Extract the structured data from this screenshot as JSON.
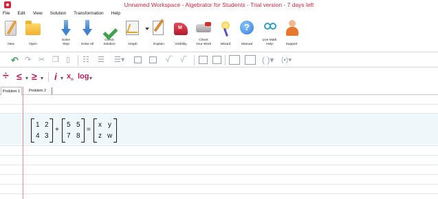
{
  "window": {
    "title": "Unnamed Workspace - Algebrator for Students - Trial version - 7 days left",
    "accent_color": "#d7263d"
  },
  "menu": [
    "File",
    "Edit",
    "View",
    "Solution",
    "Transformation",
    "Help"
  ],
  "toolbar": {
    "new": "New",
    "open": "Open",
    "solve_step_1": "Solve",
    "solve_step_2": "Step",
    "solve_all": "Solve All",
    "check_solution_1": "Check",
    "check_solution_2": "Solution",
    "graph": "Graph",
    "explain": "Explain",
    "visibility": "Visibility",
    "check_work_1": "Check",
    "check_work_2": "Your Work",
    "wizard": "Wizard",
    "manual": "Manual",
    "live_help_1": "Live Math",
    "live_help_2": "Help",
    "support": "Support"
  },
  "math_toolbar": {
    "divide": "÷",
    "less_equal": "≤",
    "greater_equal": "≥",
    "imaginary": "i",
    "subscript_x": "x",
    "subscript_label": "n",
    "log": "log",
    "dropdown": "▾"
  },
  "tabs": [
    {
      "label": "Problem 1",
      "active": true
    },
    {
      "label": "Problem 2",
      "active": false
    }
  ],
  "expression": {
    "matrix_a": [
      "1",
      "2",
      "4",
      "3"
    ],
    "plus": "+",
    "matrix_b": [
      "5",
      "5",
      "7",
      "8"
    ],
    "equals": "=",
    "matrix_c": [
      "x",
      "y",
      "z",
      "w"
    ]
  },
  "icons": [
    "new-icon",
    "open-icon",
    "solve-step-icon",
    "solve-all-icon",
    "check-solution-icon",
    "graph-icon",
    "explain-icon",
    "visibility-icon",
    "check-work-icon",
    "wizard-icon",
    "manual-icon",
    "live-help-icon",
    "support-icon",
    "undo-icon",
    "redo-icon",
    "cut-icon",
    "copy-icon",
    "paste-icon"
  ]
}
